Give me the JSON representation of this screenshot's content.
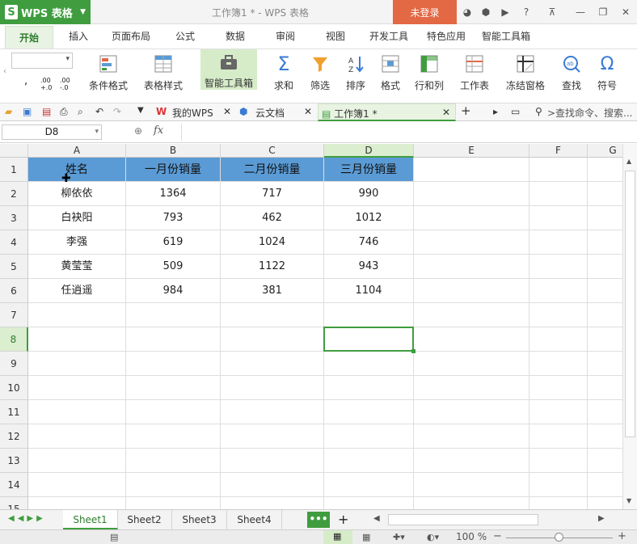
{
  "app": {
    "name": "WPS 表格",
    "logo": "S",
    "doc_title": "工作簿1 * - WPS 表格",
    "login": "未登录"
  },
  "menu_tabs": [
    "开始",
    "插入",
    "页面布局",
    "公式",
    "数据",
    "审阅",
    "视图",
    "开发工具",
    "特色应用",
    "智能工具箱"
  ],
  "ribbon": {
    "tools": [
      {
        "label": "条件格式",
        "icon": "conditional-format-icon"
      },
      {
        "label": "表格样式",
        "icon": "table-style-icon"
      },
      {
        "label": "智能工具箱",
        "icon": "toolbox-icon"
      },
      {
        "label": "求和",
        "icon": "sum-icon"
      },
      {
        "label": "筛选",
        "icon": "filter-icon"
      },
      {
        "label": "排序",
        "icon": "sort-icon"
      },
      {
        "label": "格式",
        "icon": "format-icon"
      },
      {
        "label": "行和列",
        "icon": "row-column-icon"
      },
      {
        "label": "工作表",
        "icon": "worksheet-icon"
      },
      {
        "label": "冻结窗格",
        "icon": "freeze-pane-icon"
      },
      {
        "label": "查找",
        "icon": "find-icon"
      },
      {
        "label": "符号",
        "icon": "symbol-icon"
      }
    ],
    "small_glyphs": {
      "comma": ",",
      "inc_decimal": ".00 +.0",
      "dec_decimal": ".00 -.0"
    }
  },
  "doc_tabs": {
    "mywps": "我的WPS",
    "cloud": "云文档",
    "current": "工作簿1 *",
    "search": ">查找命令、搜索..."
  },
  "formula_bar": {
    "cell_ref": "D8",
    "fx": "fx",
    "value": ""
  },
  "columns": [
    "A",
    "B",
    "C",
    "D",
    "E",
    "F",
    "G"
  ],
  "rows": [
    "1",
    "2",
    "3",
    "4",
    "5",
    "6",
    "7",
    "8",
    "9",
    "10",
    "11",
    "12",
    "13",
    "14",
    "15"
  ],
  "table": {
    "headers": [
      "姓名",
      "一月份销量",
      "二月份销量",
      "三月份销量"
    ],
    "data": [
      [
        "柳依依",
        "1364",
        "717",
        "990"
      ],
      [
        "白袂阳",
        "793",
        "462",
        "1012"
      ],
      [
        "李强",
        "619",
        "1024",
        "746"
      ],
      [
        "黄莹莹",
        "509",
        "1122",
        "943"
      ],
      [
        "任逍遥",
        "984",
        "381",
        "1104"
      ]
    ]
  },
  "selected_cell": "D8",
  "sheets": [
    "Sheet1",
    "Sheet2",
    "Sheet3",
    "Sheet4"
  ],
  "active_sheet": "Sheet1",
  "status": {
    "zoom": "100 %"
  },
  "colors": {
    "accent": "#3f9d3f",
    "header_fill": "#5b9bd5",
    "login": "#e36844"
  }
}
